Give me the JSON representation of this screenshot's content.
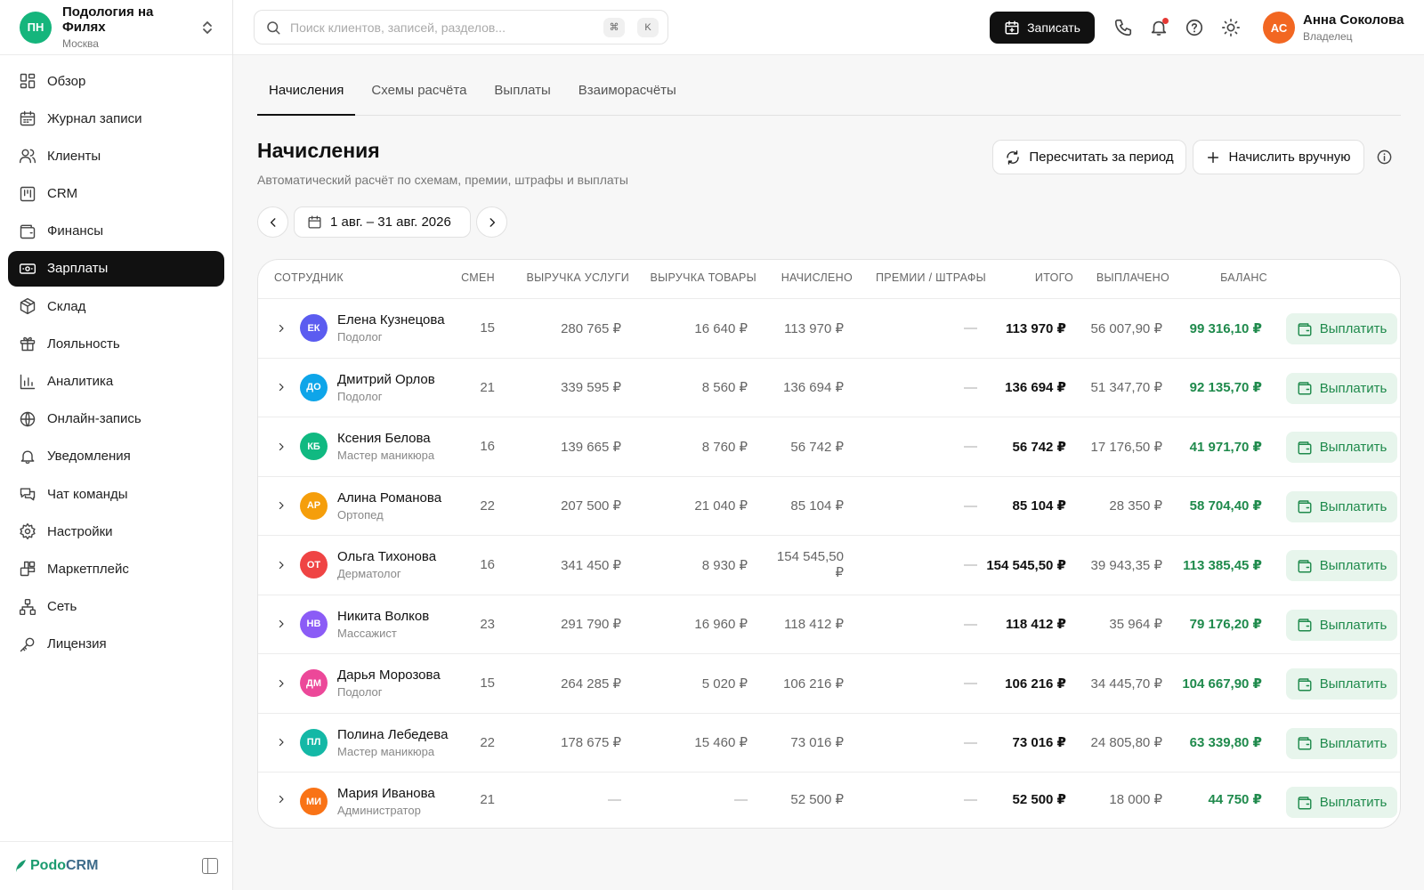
{
  "org": {
    "initials": "ПН",
    "name": "Подология на Филях",
    "city": "Москва"
  },
  "nav": [
    {
      "label": "Обзор",
      "icon": "grid-icon",
      "active": false
    },
    {
      "label": "Журнал записи",
      "icon": "calendar-icon",
      "active": false
    },
    {
      "label": "Клиенты",
      "icon": "users-icon",
      "active": false
    },
    {
      "label": "CRM",
      "icon": "kanban-icon",
      "active": false
    },
    {
      "label": "Финансы",
      "icon": "wallet-icon",
      "active": false
    },
    {
      "label": "Зарплаты",
      "icon": "banknote-icon",
      "active": true
    },
    {
      "label": "Склад",
      "icon": "box-icon",
      "active": false
    },
    {
      "label": "Лояльность",
      "icon": "gift-icon",
      "active": false
    },
    {
      "label": "Аналитика",
      "icon": "bar-chart-icon",
      "active": false
    },
    {
      "label": "Онлайн-запись",
      "icon": "globe-icon",
      "active": false
    },
    {
      "label": "Уведомления",
      "icon": "bell-icon",
      "active": false
    },
    {
      "label": "Чат команды",
      "icon": "chat-icon",
      "active": false
    },
    {
      "label": "Настройки",
      "icon": "gear-icon",
      "active": false
    },
    {
      "label": "Маркетплейс",
      "icon": "blocks-icon",
      "active": false
    },
    {
      "label": "Сеть",
      "icon": "network-icon",
      "active": false
    },
    {
      "label": "Лицензия",
      "icon": "key-icon",
      "active": false
    }
  ],
  "brand": {
    "part1": "Podo",
    "part2": "CRM"
  },
  "search": {
    "placeholder": "Поиск клиентов, записей, разделов...",
    "key1": "⌘",
    "key2": "K"
  },
  "header": {
    "record_label": "Записать"
  },
  "user": {
    "initials": "АС",
    "name": "Анна Соколова",
    "role": "Владелец"
  },
  "tabs": [
    "Начисления",
    "Схемы расчёта",
    "Выплаты",
    "Взаиморасчёты"
  ],
  "page": {
    "title": "Начисления",
    "subtitle": "Автоматический расчёт по схемам, премии, штрафы и выплаты",
    "recalc_label": "Пересчитать за период",
    "manual_label": "Начислить вручную",
    "period": "1 авг. – 31 авг. 2026"
  },
  "table": {
    "columns": [
      "СОТРУДНИК",
      "СМЕН",
      "ВЫРУЧКА УСЛУГИ",
      "ВЫРУЧКА ТОВАРЫ",
      "НАЧИСЛЕНО",
      "ПРЕМИИ / ШТРАФЫ",
      "ИТОГО",
      "ВЫПЛАЧЕНО",
      "БАЛАНС"
    ],
    "pay_label": "Выплатить",
    "rows": [
      {
        "initials": "ЕК",
        "color": "#5b5cf0",
        "name": "Елена Кузнецова",
        "role": "Подолог",
        "shifts": "15",
        "services": "280 765 ₽",
        "goods": "16 640 ₽",
        "accrued": "113 970 ₽",
        "bonuses": "—",
        "total": "113 970 ₽",
        "paid": "56 007,90 ₽",
        "balance": "99 316,10 ₽"
      },
      {
        "initials": "ДО",
        "color": "#0ea5e9",
        "name": "Дмитрий Орлов",
        "role": "Подолог",
        "shifts": "21",
        "services": "339 595 ₽",
        "goods": "8 560 ₽",
        "accrued": "136 694 ₽",
        "bonuses": "—",
        "total": "136 694 ₽",
        "paid": "51 347,70 ₽",
        "balance": "92 135,70 ₽"
      },
      {
        "initials": "КБ",
        "color": "#10b981",
        "name": "Ксения Белова",
        "role": "Мастер маникюра",
        "shifts": "16",
        "services": "139 665 ₽",
        "goods": "8 760 ₽",
        "accrued": "56 742 ₽",
        "bonuses": "—",
        "total": "56 742 ₽",
        "paid": "17 176,50 ₽",
        "balance": "41 971,70 ₽"
      },
      {
        "initials": "АР",
        "color": "#f59e0b",
        "name": "Алина Романова",
        "role": "Ортопед",
        "shifts": "22",
        "services": "207 500 ₽",
        "goods": "21 040 ₽",
        "accrued": "85 104 ₽",
        "bonuses": "—",
        "total": "85 104 ₽",
        "paid": "28 350 ₽",
        "balance": "58 704,40 ₽"
      },
      {
        "initials": "ОТ",
        "color": "#ef4444",
        "name": "Ольга Тихонова",
        "role": "Дерматолог",
        "shifts": "16",
        "services": "341 450 ₽",
        "goods": "8 930 ₽",
        "accrued": "154 545,50 ₽",
        "bonuses": "—",
        "total": "154 545,50 ₽",
        "paid": "39 943,35 ₽",
        "balance": "113 385,45 ₽"
      },
      {
        "initials": "НВ",
        "color": "#8b5cf6",
        "name": "Никита Волков",
        "role": "Массажист",
        "shifts": "23",
        "services": "291 790 ₽",
        "goods": "16 960 ₽",
        "accrued": "118 412 ₽",
        "bonuses": "—",
        "total": "118 412 ₽",
        "paid": "35 964 ₽",
        "balance": "79 176,20 ₽"
      },
      {
        "initials": "ДМ",
        "color": "#ec4899",
        "name": "Дарья Морозова",
        "role": "Подолог",
        "shifts": "15",
        "services": "264 285 ₽",
        "goods": "5 020 ₽",
        "accrued": "106 216 ₽",
        "bonuses": "—",
        "total": "106 216 ₽",
        "paid": "34 445,70 ₽",
        "balance": "104 667,90 ₽"
      },
      {
        "initials": "ПЛ",
        "color": "#14b8a6",
        "name": "Полина Лебедева",
        "role": "Мастер маникюра",
        "shifts": "22",
        "services": "178 675 ₽",
        "goods": "15 460 ₽",
        "accrued": "73 016 ₽",
        "bonuses": "—",
        "total": "73 016 ₽",
        "paid": "24 805,80 ₽",
        "balance": "63 339,80 ₽"
      },
      {
        "initials": "МИ",
        "color": "#f97316",
        "name": "Мария Иванова",
        "role": "Администратор",
        "shifts": "21",
        "services": "—",
        "goods": "—",
        "accrued": "52 500 ₽",
        "bonuses": "—",
        "total": "52 500 ₽",
        "paid": "18 000 ₽",
        "balance": "44 750 ₽"
      }
    ]
  }
}
